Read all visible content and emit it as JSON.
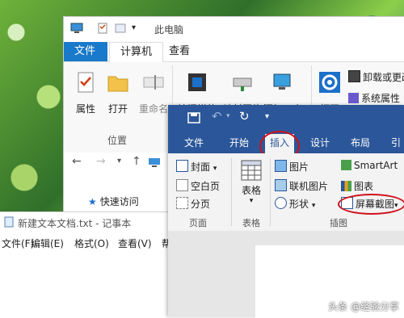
{
  "explorer": {
    "title": "此电脑",
    "tabs": {
      "file": "文件",
      "computer": "计算机",
      "view": "查看"
    },
    "ribbon": {
      "properties": "属性",
      "open": "打开",
      "rename": "重命名",
      "access_media": "访问媒体",
      "map_network": "映射网络",
      "add_location": "添加一个",
      "open2": "打开",
      "uninstall": "卸载或更改",
      "system_props": "系统属性",
      "group_location": "位置"
    },
    "quick_access": "快速访问"
  },
  "notepad": {
    "title": "新建文本文档.txt - 记事本",
    "menu": [
      "文件(F)",
      "编辑(E)",
      "格式(O)",
      "查看(V)",
      "帮"
    ]
  },
  "word": {
    "tabs": [
      "文件",
      "开始",
      "插入",
      "设计",
      "布局",
      "引"
    ],
    "ribbon": {
      "cover": "封面",
      "blank_page": "空白页",
      "page_break": "分页",
      "group_pages": "页面",
      "table": "表格",
      "group_table": "表格",
      "picture": "图片",
      "online_picture": "联机图片",
      "shapes": "形状",
      "smartart": "SmartArt",
      "chart": "图表",
      "screenshot": "屏幕截图",
      "group_illustrations": "插图"
    }
  },
  "watermark": "头条 @经验分享",
  "colors": {
    "word_blue": "#2b579a",
    "file_tab_blue": "#1979ca",
    "annotation_red": "#d0101a"
  }
}
